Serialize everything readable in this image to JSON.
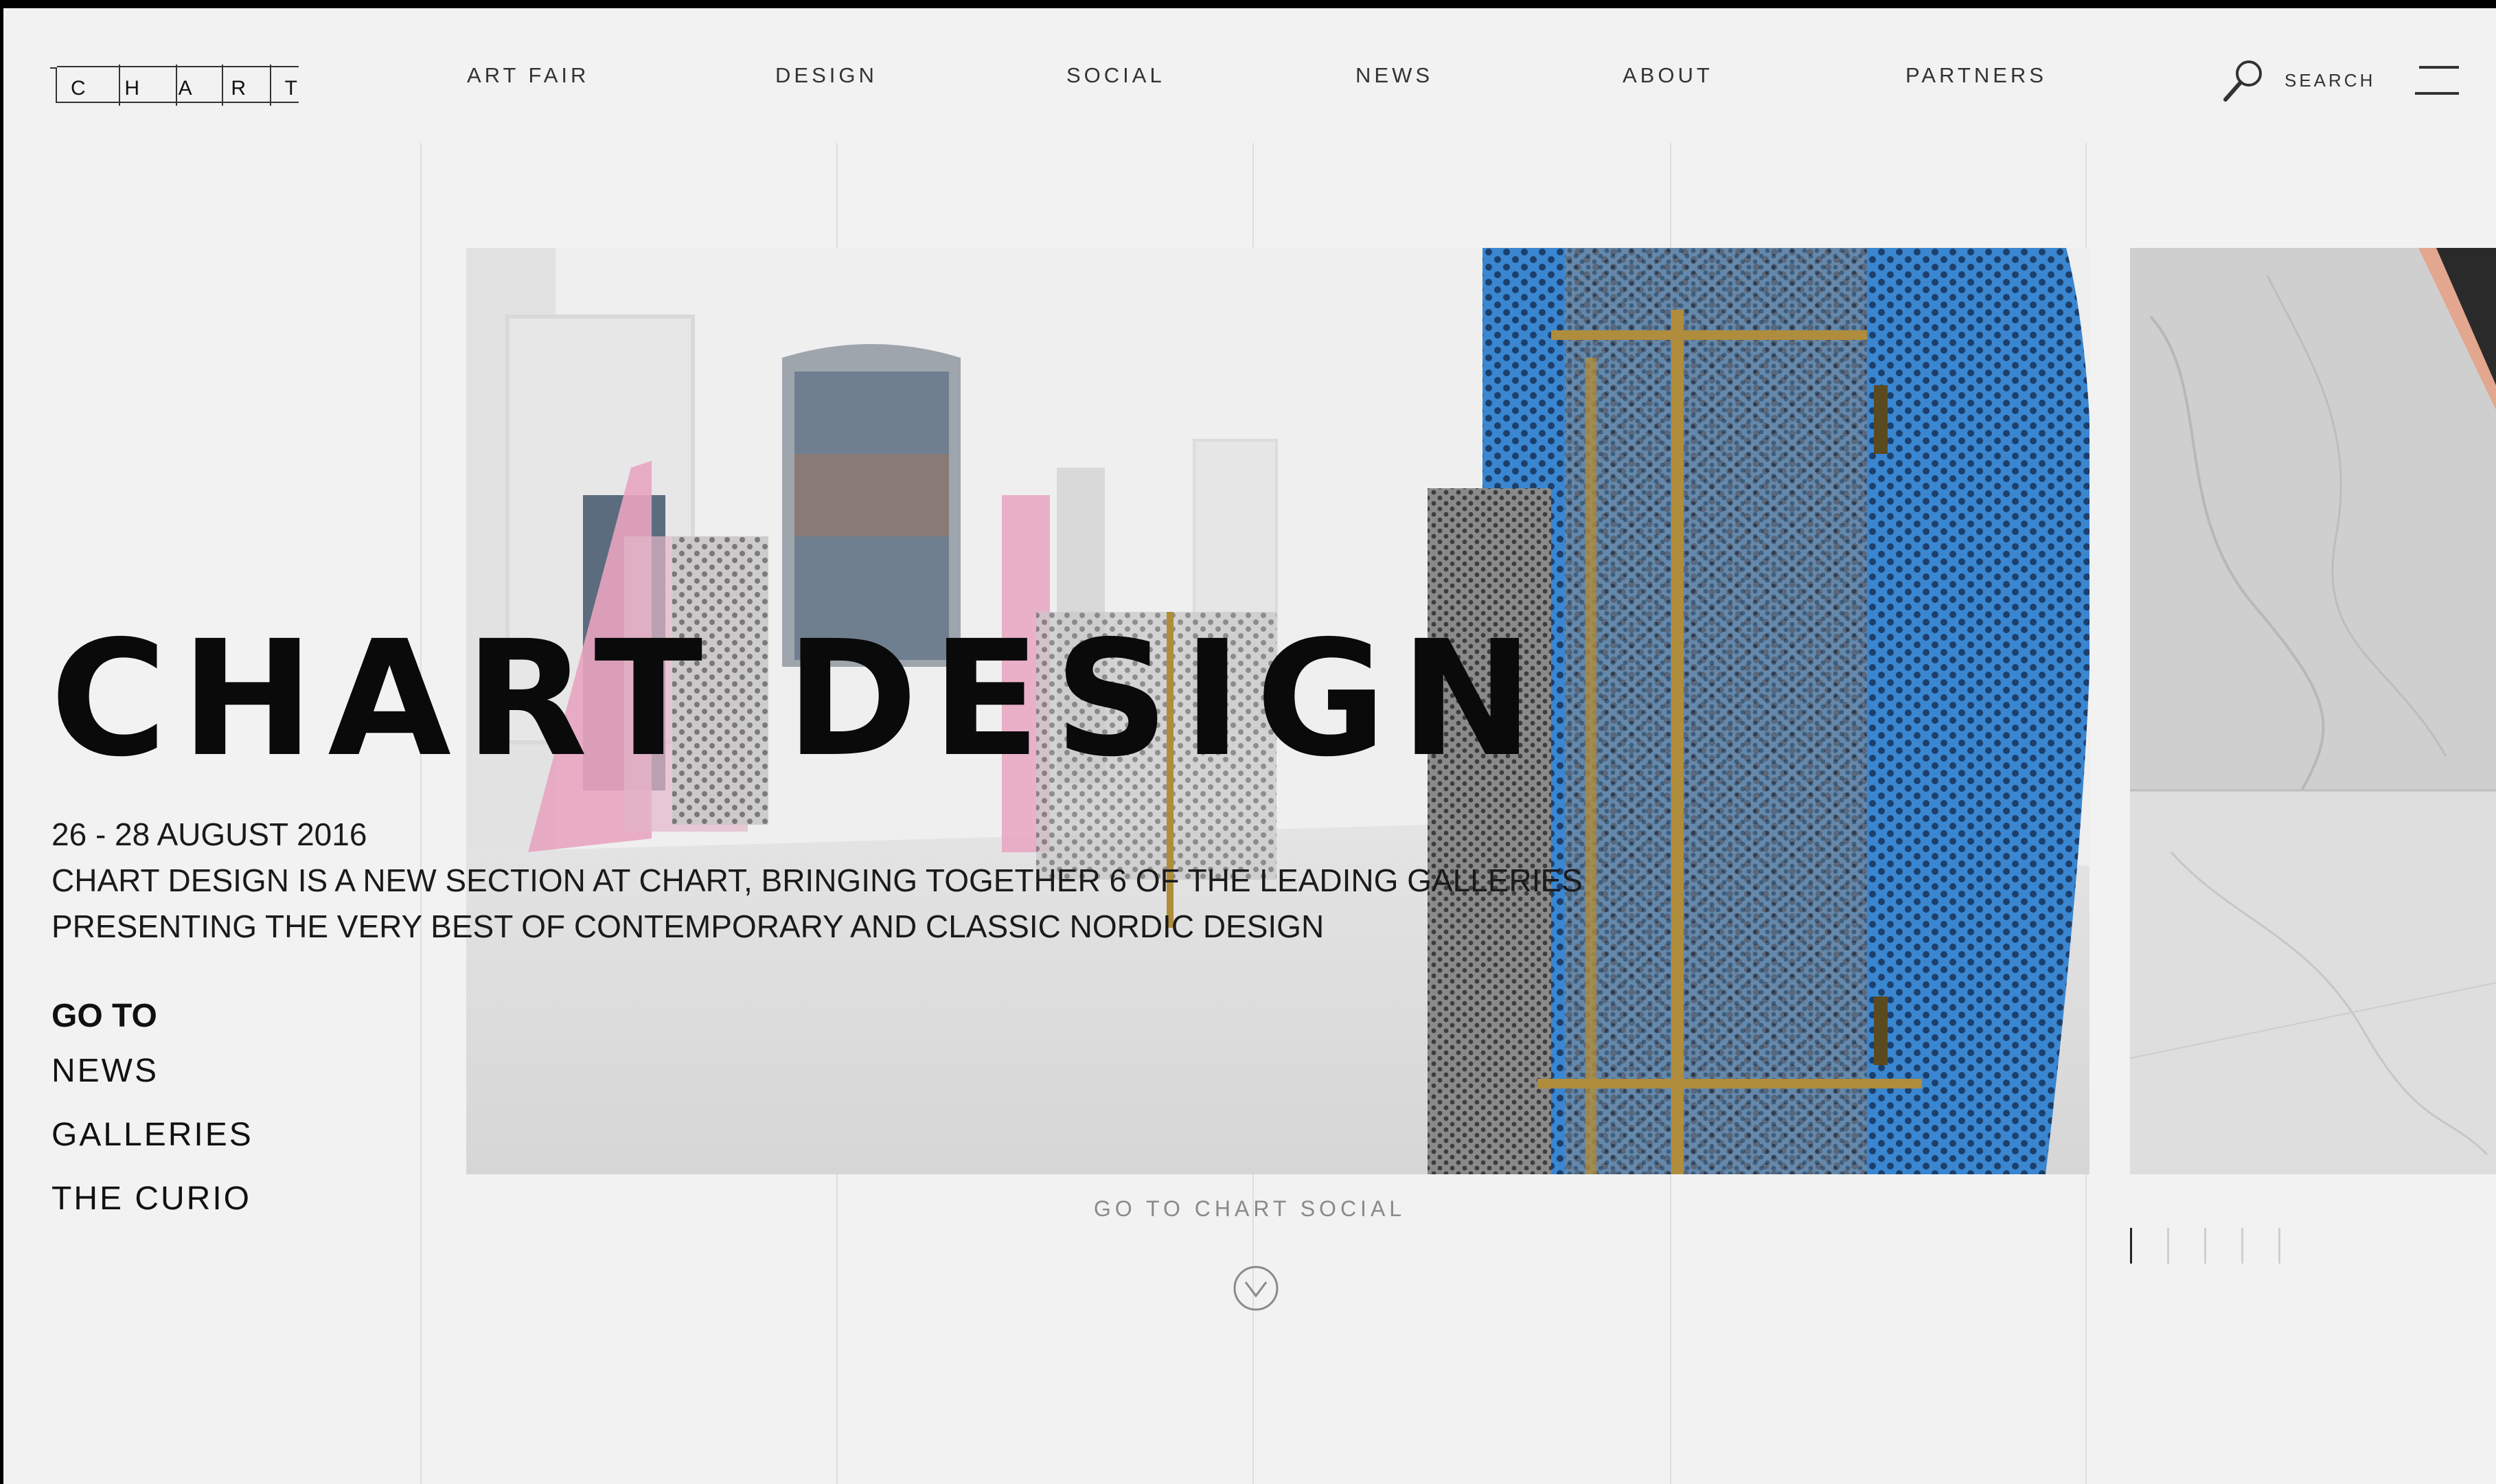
{
  "header": {
    "logo_letters": [
      "C",
      "H",
      "A",
      "R",
      "T"
    ],
    "nav": [
      {
        "label": "ART FAIR"
      },
      {
        "label": "DESIGN"
      },
      {
        "label": "SOCIAL"
      },
      {
        "label": "NEWS"
      },
      {
        "label": "ABOUT"
      },
      {
        "label": "PARTNERS"
      }
    ],
    "search_label": "SEARCH",
    "search_icon": "search-icon",
    "menu_icon": "hamburger-menu-icon"
  },
  "hero": {
    "title": "CHART DESIGN",
    "date": "26 - 28 AUGUST 2016",
    "description_line_1": "CHART DESIGN IS A NEW SECTION AT CHART, BRINGING TOGETHER 6 OF THE LEADING GALLERIES",
    "description_line_2": "PRESENTING THE VERY BEST OF CONTEMPORARY AND CLASSIC NORDIC DESIGN"
  },
  "goto": {
    "heading": "GO TO",
    "links": [
      {
        "label": "NEWS"
      },
      {
        "label": "GALLERIES"
      },
      {
        "label": "THE CURIO"
      }
    ]
  },
  "social_link": "GO TO CHART SOCIAL",
  "scroll_icon": "chevron-down-circle-icon",
  "slider": {
    "total_slides": 5,
    "active_slide": 1
  },
  "colors": {
    "background": "#f2f2f2",
    "text": "#111111",
    "accent_blue": "#3a86d0",
    "accent_pink": "#e8a4c0",
    "accent_brass": "#b08d3c",
    "muted": "#8a8a8a"
  }
}
